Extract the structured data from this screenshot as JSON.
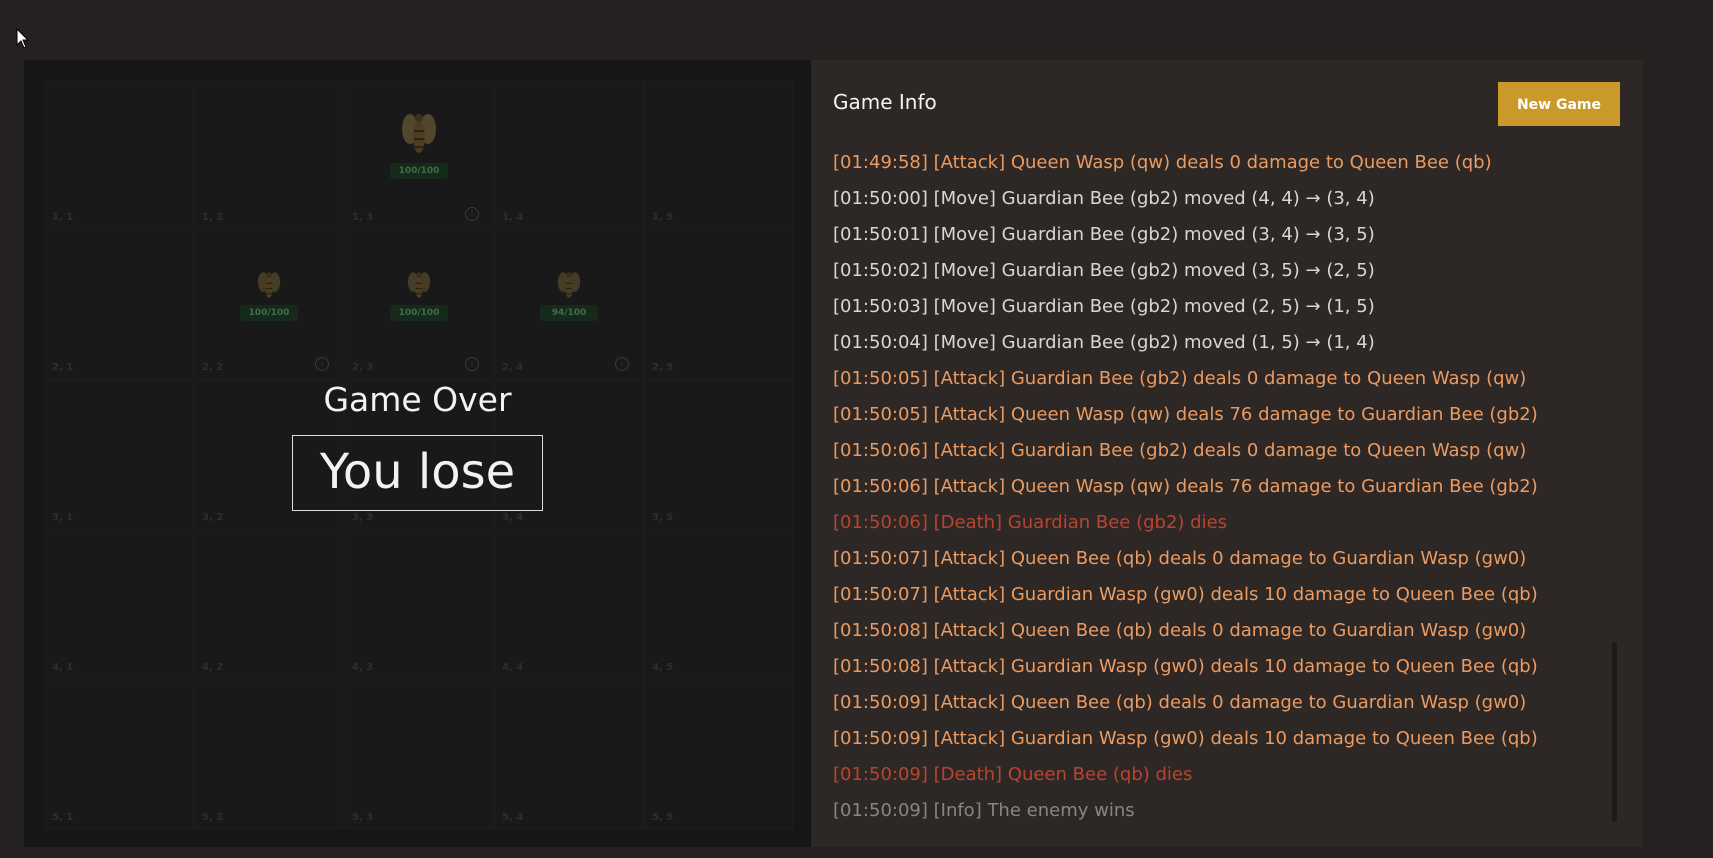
{
  "colors": {
    "background": "#242120",
    "board_bg": "#161616",
    "panel_bg": "#2d2726",
    "accent_button": "#c99a2a",
    "log_attack": "#eb9b61",
    "log_move": "#dcd6d2",
    "log_death": "#b8452f",
    "log_info": "#8a8482"
  },
  "board": {
    "cells": [
      {
        "label": "1, 1"
      },
      {
        "label": "1, 2"
      },
      {
        "label": "1, 3",
        "unit": {
          "type": "bee",
          "kind": "queen",
          "hp": "100/100"
        },
        "info": true
      },
      {
        "label": "1, 4"
      },
      {
        "label": "1, 5"
      },
      {
        "label": "2, 1"
      },
      {
        "label": "2, 2",
        "unit": {
          "type": "wasp",
          "kind": "guardian",
          "hp": "100/100"
        },
        "info": true
      },
      {
        "label": "2, 3",
        "unit": {
          "type": "wasp",
          "kind": "guardian",
          "hp": "100/100"
        },
        "info": true
      },
      {
        "label": "2, 4",
        "unit": {
          "type": "wasp",
          "kind": "guardian",
          "hp": "94/100"
        },
        "info": true
      },
      {
        "label": "2, 5"
      },
      {
        "label": "3, 1"
      },
      {
        "label": "3, 2"
      },
      {
        "label": "3, 3"
      },
      {
        "label": "3, 4"
      },
      {
        "label": "3, 5"
      },
      {
        "label": "4, 1"
      },
      {
        "label": "4, 2"
      },
      {
        "label": "4, 3"
      },
      {
        "label": "4, 4"
      },
      {
        "label": "4, 5"
      },
      {
        "label": "5, 1"
      },
      {
        "label": "5, 2"
      },
      {
        "label": "5, 3"
      },
      {
        "label": "5, 4"
      },
      {
        "label": "5, 5"
      }
    ]
  },
  "game_over": {
    "title": "Game Over",
    "result": "You lose"
  },
  "info_panel": {
    "title": "Game Info",
    "new_game_label": "New Game",
    "log": [
      {
        "type": "attack",
        "text": "[01:49:58] [Attack] Queen Wasp (qw) deals 0 damage to Queen Bee (qb)"
      },
      {
        "type": "move",
        "text": "[01:50:00] [Move] Guardian Bee (gb2) moved (4, 4) → (3, 4)"
      },
      {
        "type": "move",
        "text": "[01:50:01] [Move] Guardian Bee (gb2) moved (3, 4) → (3, 5)"
      },
      {
        "type": "move",
        "text": "[01:50:02] [Move] Guardian Bee (gb2) moved (3, 5) → (2, 5)"
      },
      {
        "type": "move",
        "text": "[01:50:03] [Move] Guardian Bee (gb2) moved (2, 5) → (1, 5)"
      },
      {
        "type": "move",
        "text": "[01:50:04] [Move] Guardian Bee (gb2) moved (1, 5) → (1, 4)"
      },
      {
        "type": "attack",
        "text": "[01:50:05] [Attack] Guardian Bee (gb2) deals 0 damage to Queen Wasp (qw)"
      },
      {
        "type": "attack",
        "text": "[01:50:05] [Attack] Queen Wasp (qw) deals 76 damage to Guardian Bee (gb2)"
      },
      {
        "type": "attack",
        "text": "[01:50:06] [Attack] Guardian Bee (gb2) deals 0 damage to Queen Wasp (qw)"
      },
      {
        "type": "attack",
        "text": "[01:50:06] [Attack] Queen Wasp (qw) deals 76 damage to Guardian Bee (gb2)"
      },
      {
        "type": "death",
        "text": "[01:50:06] [Death] Guardian Bee (gb2) dies"
      },
      {
        "type": "attack",
        "text": "[01:50:07] [Attack] Queen Bee (qb) deals 0 damage to Guardian Wasp (gw0)"
      },
      {
        "type": "attack",
        "text": "[01:50:07] [Attack] Guardian Wasp (gw0) deals 10 damage to Queen Bee (qb)"
      },
      {
        "type": "attack",
        "text": "[01:50:08] [Attack] Queen Bee (qb) deals 0 damage to Guardian Wasp (gw0)"
      },
      {
        "type": "attack",
        "text": "[01:50:08] [Attack] Guardian Wasp (gw0) deals 10 damage to Queen Bee (qb)"
      },
      {
        "type": "attack",
        "text": "[01:50:09] [Attack] Queen Bee (qb) deals 0 damage to Guardian Wasp (gw0)"
      },
      {
        "type": "attack",
        "text": "[01:50:09] [Attack] Guardian Wasp (gw0) deals 10 damage to Queen Bee (qb)"
      },
      {
        "type": "death",
        "text": "[01:50:09] [Death] Queen Bee (qb) dies"
      },
      {
        "type": "info",
        "text": "[01:50:09] [Info] The enemy wins"
      }
    ]
  }
}
